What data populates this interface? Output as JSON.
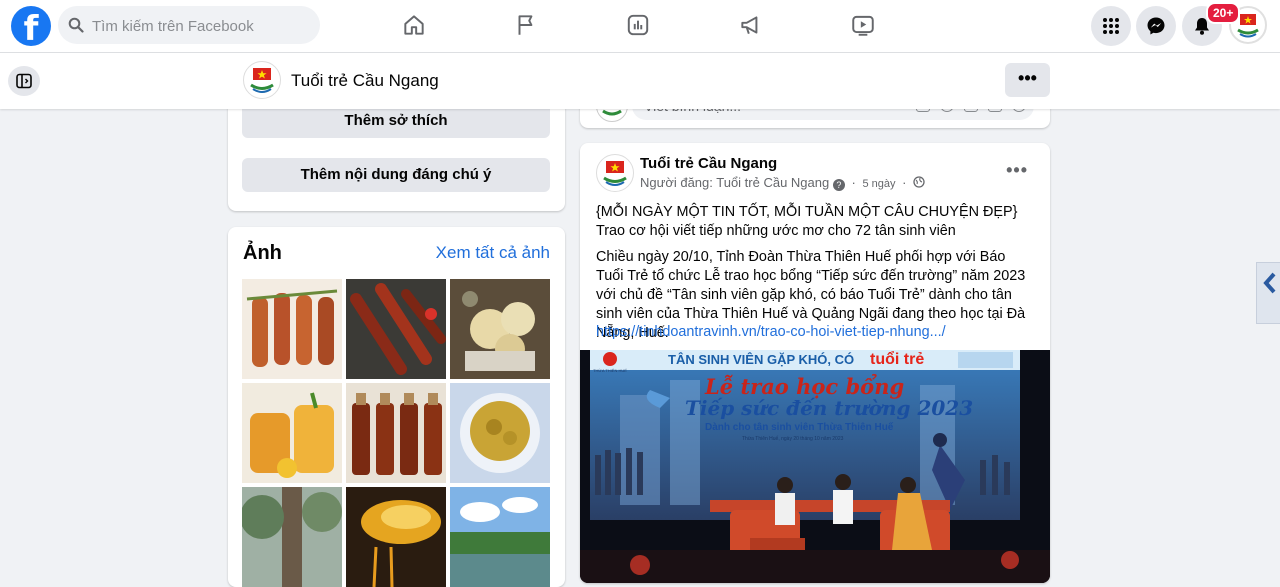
{
  "topbar": {
    "logo_letter": "f",
    "search_placeholder": "Tìm kiếm trên Facebook",
    "nav_icons": [
      "home-icon",
      "pages-flag-icon",
      "insights-icon",
      "ads-megaphone-icon",
      "video-play-icon"
    ],
    "notification_badge": "20+",
    "brand_color": "#1877f2"
  },
  "subheader": {
    "page_name": "Tuổi trẻ Cầu Ngang",
    "more_label": "•••"
  },
  "intro": {
    "add_hobbies_label": "Thêm sở thích",
    "add_featured_label": "Thêm nội dung đáng chú ý"
  },
  "photos": {
    "title": "Ảnh",
    "see_all_label": "Xem tất cả ảnh"
  },
  "composer": {
    "placeholder": "Viết bình luận..."
  },
  "post": {
    "author": "Tuổi trẻ Cầu Ngang",
    "meta_prefix": "Người đăng: Tuổi trẻ Cầu Ngang",
    "time": "5 ngày",
    "headline": "{MỖI NGÀY MỘT TIN TỐT, MỖI TUẦN MỘT CÂU CHUYỆN ĐẸP}",
    "subline": "Trao cơ hội viết tiếp những ước mơ cho 72 tân sinh viên",
    "body": "Chiều ngày 20/10, Tỉnh Đoàn Thừa Thiên Huế phối hợp với Báo Tuổi Trẻ tổ chức Lễ trao học bổng “Tiếp sức đến trường” năm 2023 với chủ đề “Tân sinh viên gặp khó, có báo Tuổi Trẻ” dành cho tân sinh viên của Thừa Thiên Huế và Quảng Ngãi đang theo học tại Đà Nẵng, Huế.",
    "link": "https://tinhdoantravinh.vn/trao-co-hoi-viet-tiep-nhung.../",
    "image": {
      "banner_top": "TÂN SINH VIÊN GẶP KHÓ, CÓ",
      "banner_brand": "tuổi trẻ",
      "title_line1": "Lễ trao học bổng",
      "title_line2": "Tiếp sức đến trường 2023",
      "subtitle": "Dành cho tân sinh viên Thừa Thiên Huế",
      "small_date": "Thừa Thiên Huế, ngày 20 tháng 10 năm 2023",
      "logo_text": "THỪA THIÊN HUẾ"
    }
  }
}
